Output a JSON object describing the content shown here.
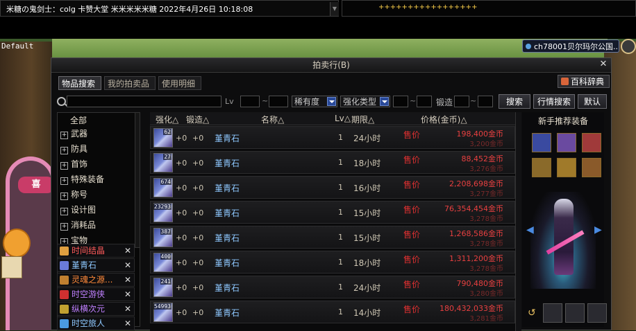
{
  "chat": {
    "message": "米糖の鬼剑士：colg 卡赞大堂 米米米米米糖 2022年4月26日 10:18:08",
    "notice": "+++++++++++++++++"
  },
  "scene": {
    "default_label": "Default",
    "channel": "ch78001贝尔玛尔公国..",
    "arch_sign": "喜"
  },
  "auction": {
    "title": "拍卖行(B)",
    "tabs": [
      "物品搜索",
      "我的拍卖品",
      "使用明细"
    ],
    "dict_label": "百科辞典",
    "filters": {
      "lv_label": "Lv",
      "tilde": "~",
      "rarity": "稀有度",
      "enhance_type": "强化类型",
      "forge_label": "锻造"
    },
    "buttons": {
      "search": "搜索",
      "market": "行情搜索",
      "default": "默认"
    },
    "categories": {
      "all": "全部",
      "items": [
        "武器",
        "防具",
        "首饰",
        "特殊装备",
        "称号",
        "设计图",
        "消耗品",
        "宝物"
      ]
    },
    "favorites": [
      {
        "label": "时间结晶",
        "color": "#ff5a5a",
        "icon_color": "#e0a040"
      },
      {
        "label": "堇青石",
        "color": "#8ec8ff",
        "icon_color": "#6a7ad8"
      },
      {
        "label": "灵魂之源...",
        "color": "#ff8a3a",
        "icon_color": "#c08030"
      },
      {
        "label": "时空游侠",
        "color": "#c080ff",
        "icon_color": "#d03030"
      },
      {
        "label": "纵横次元",
        "color": "#c080ff",
        "icon_color": "#c0a030"
      },
      {
        "label": "时空旅人",
        "color": "#8ec8ff",
        "icon_color": "#4a9ae0"
      }
    ],
    "columns": [
      "强化△",
      "锻造△",
      "名称△",
      "Lv△",
      "期限△",
      "价格(金币)△"
    ],
    "rows": [
      {
        "qty": "62",
        "enhance": "+0",
        "forge": "+0",
        "name": "堇青石",
        "lv": "1",
        "duration": "24小时",
        "price_label": "售价",
        "price": "198,400金币",
        "price_note": "3,200金币"
      },
      {
        "qty": "27",
        "enhance": "+0",
        "forge": "+0",
        "name": "堇青石",
        "lv": "1",
        "duration": "18小时",
        "price_label": "售价",
        "price": "88,452金币",
        "price_note": "3,276金币"
      },
      {
        "qty": "674",
        "enhance": "+0",
        "forge": "+0",
        "name": "堇青石",
        "lv": "1",
        "duration": "16小时",
        "price_label": "售价",
        "price": "2,208,698金币",
        "price_note": "3,277金币"
      },
      {
        "qty": "23293",
        "enhance": "+0",
        "forge": "+0",
        "name": "堇青石",
        "lv": "1",
        "duration": "15小时",
        "price_label": "售价",
        "price": "76,354,454金币",
        "price_note": "3,278金币"
      },
      {
        "qty": "387",
        "enhance": "+0",
        "forge": "+0",
        "name": "堇青石",
        "lv": "1",
        "duration": "15小时",
        "price_label": "售价",
        "price": "1,268,586金币",
        "price_note": "3,278金币"
      },
      {
        "qty": "400",
        "enhance": "+0",
        "forge": "+0",
        "name": "堇青石",
        "lv": "1",
        "duration": "18小时",
        "price_label": "售价",
        "price": "1,311,200金币",
        "price_note": "3,278金币"
      },
      {
        "qty": "241",
        "enhance": "+0",
        "forge": "+0",
        "name": "堇青石",
        "lv": "1",
        "duration": "24小时",
        "price_label": "售价",
        "price": "790,480金币",
        "price_note": "3,280金币"
      },
      {
        "qty": "54993",
        "enhance": "+0",
        "forge": "+0",
        "name": "堇青石",
        "lv": "1",
        "duration": "14小时",
        "price_label": "售价",
        "price": "180,432,033金币",
        "price_note": "3,281金币"
      }
    ],
    "recommend_title": "新手推荐装备",
    "recommend_icons": [
      {
        "name": "sword-icon",
        "color": "#3a4aa0"
      },
      {
        "name": "staff-icon",
        "color": "#6a4aa0"
      },
      {
        "name": "quest-scroll-icon",
        "color": "#a03a3a"
      },
      {
        "name": "ring-icon",
        "color": "#8a6a2a"
      },
      {
        "name": "armor-icon",
        "color": "#a07a2a"
      },
      {
        "name": "bracelet-icon",
        "color": "#8a5a2a"
      }
    ]
  }
}
